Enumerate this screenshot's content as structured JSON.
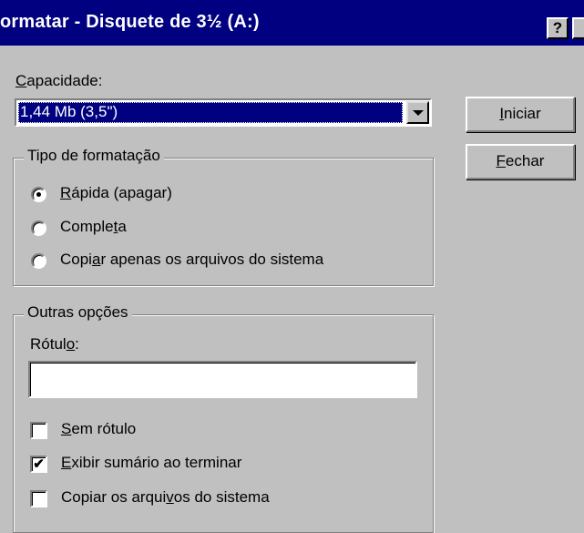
{
  "window": {
    "title": "ormatar - Disquete de 3½ (A:)",
    "help_label": "?"
  },
  "capacity": {
    "label_accel": "C",
    "label_rest": "apacidade:",
    "selected_value": "1,44 Mb (3,5\")"
  },
  "buttons": {
    "start": {
      "accel": "I",
      "rest": "niciar"
    },
    "close": {
      "accel": "F",
      "rest": "echar"
    }
  },
  "format_type": {
    "title": "Tipo de formatação",
    "options": [
      {
        "pre": "",
        "accel": "R",
        "post": "ápida (apagar)",
        "selected": true
      },
      {
        "pre": "Comple",
        "accel": "t",
        "post": "a",
        "selected": false
      },
      {
        "pre": "Copi",
        "accel": "a",
        "post": "r apenas os arquivos do sistema",
        "selected": false
      }
    ]
  },
  "other_options": {
    "title": "Outras opções",
    "label_caption": {
      "pre": "Rótul",
      "accel": "o",
      "post": ":"
    },
    "label_value": "",
    "checkboxes": [
      {
        "pre": "",
        "accel": "S",
        "post": "em rótulo",
        "checked": false
      },
      {
        "pre": "",
        "accel": "E",
        "post": "xibir sumário ao terminar",
        "checked": true
      },
      {
        "pre": "Copiar os arqui",
        "accel": "v",
        "post": "os do sistema",
        "checked": false
      }
    ]
  }
}
